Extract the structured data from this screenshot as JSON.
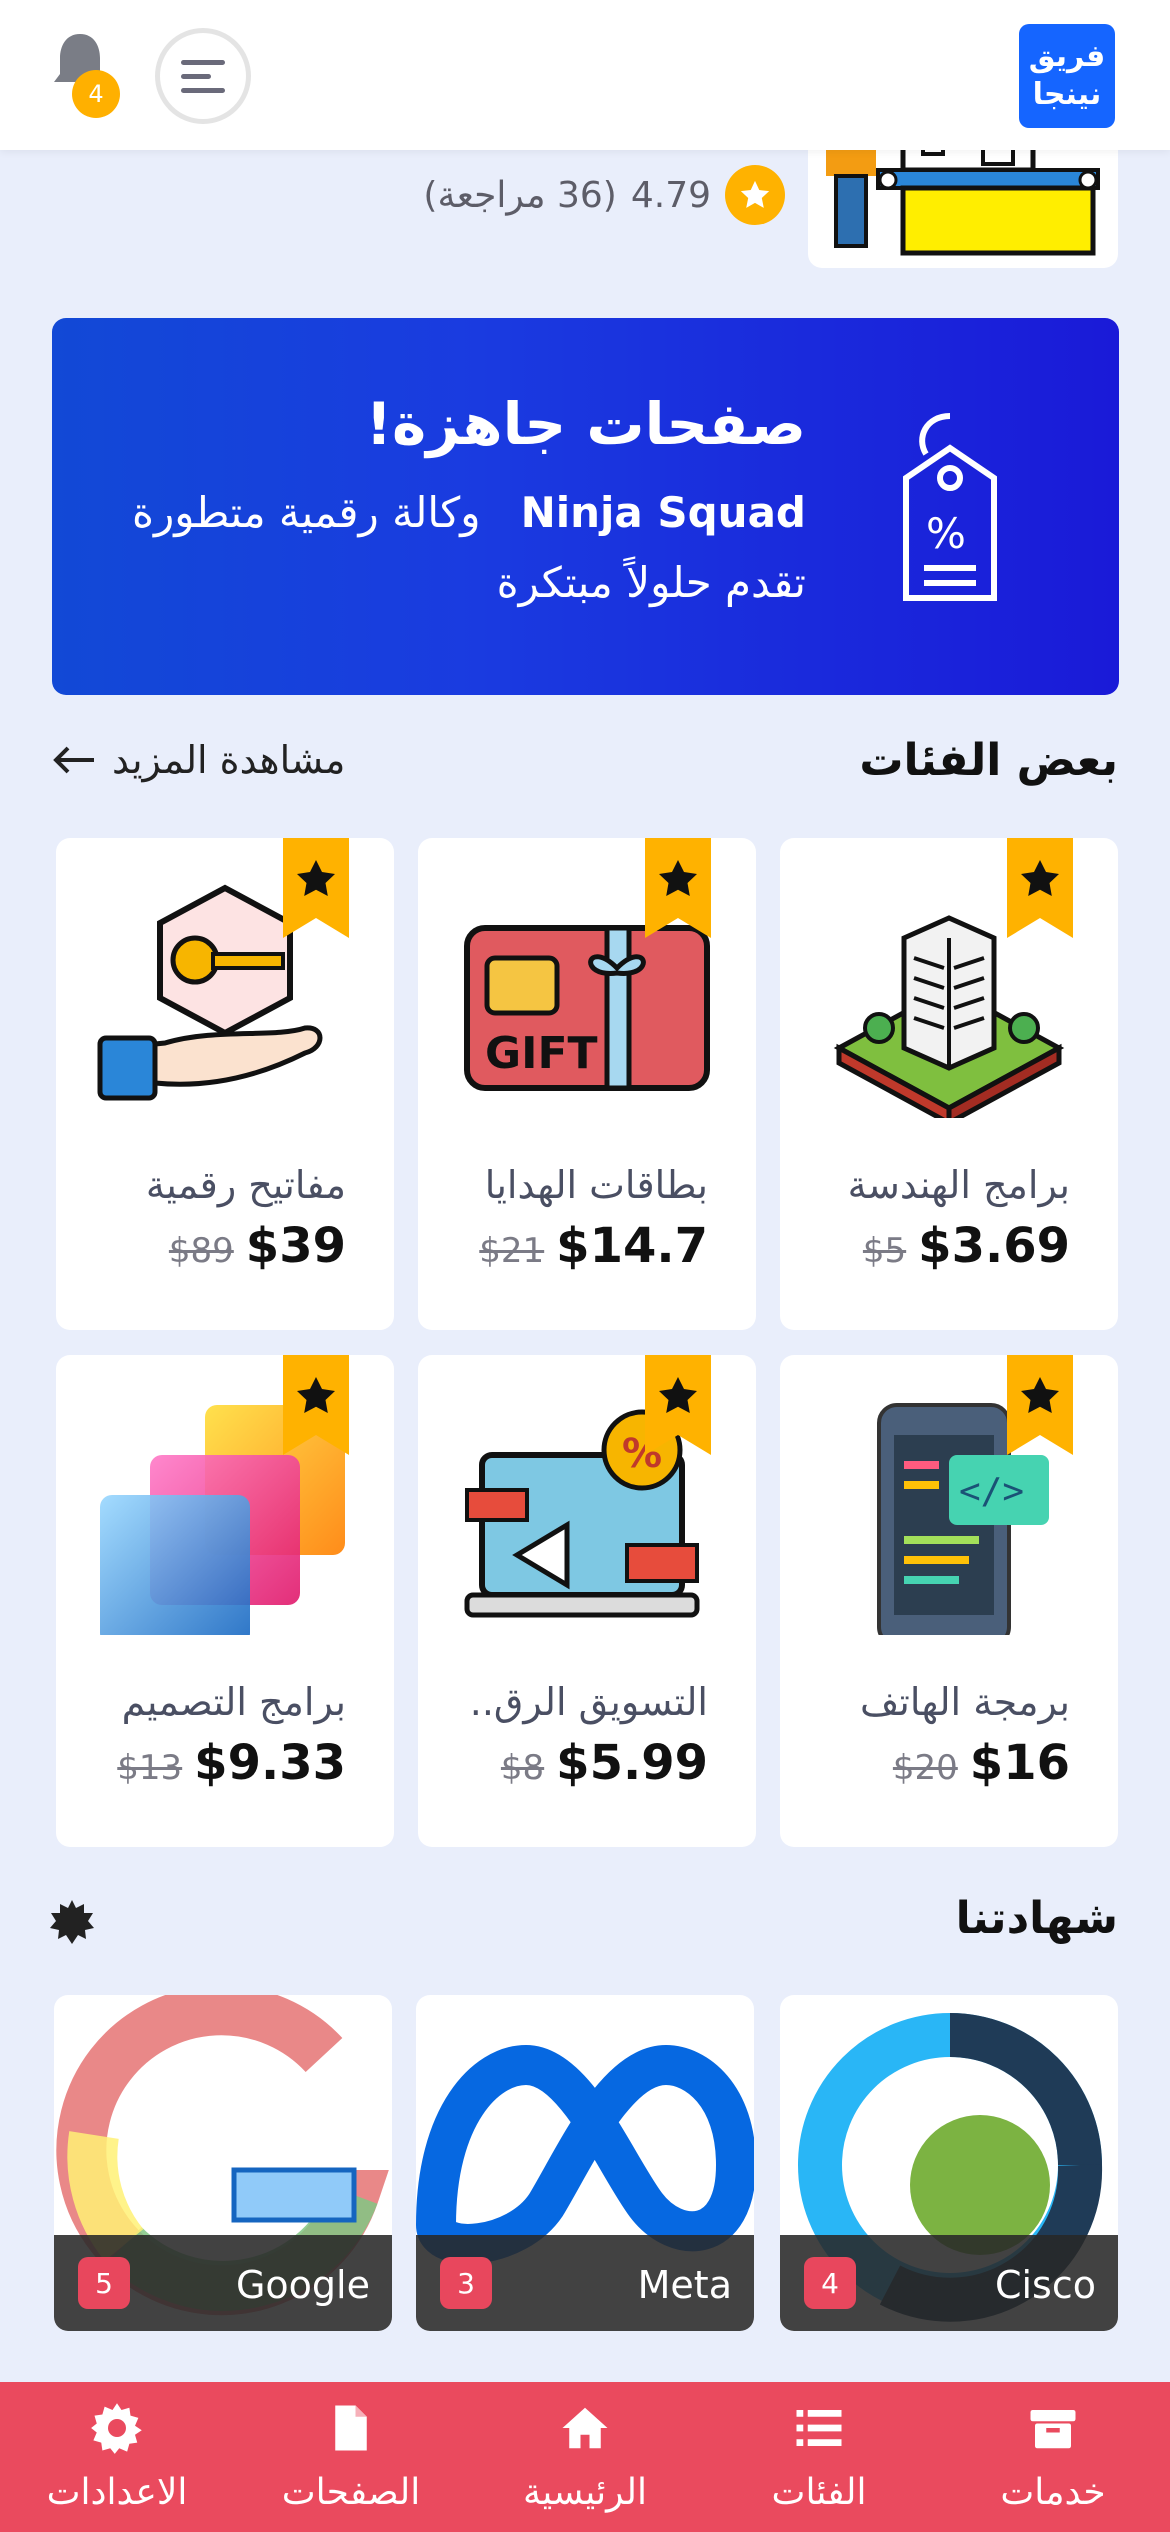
{
  "header": {
    "logo_line1": "فريق",
    "logo_line2": "نينجا",
    "notification_count": "4"
  },
  "top_product": {
    "rating": "4.79",
    "reviews": "(36 مراجعة)"
  },
  "banner": {
    "title": "صفحات جاهزة!",
    "line1_brand": "Ninja Squad",
    "line1_rest": "وكالة رقمية متطورة",
    "line2": "تقدم حلولاً مبتكرة"
  },
  "categories_section": {
    "title": "بعض الفئات",
    "see_more": "مشاهدة المزيد"
  },
  "products": [
    {
      "name": "برامج الهندسة",
      "price": "$3.69",
      "old_price": "$5",
      "icon": "building-icon"
    },
    {
      "name": "بطاقات الهدايا",
      "price": "$14.7",
      "old_price": "$21",
      "icon": "gift-card-icon"
    },
    {
      "name": "مفاتيح رقمية",
      "price": "$39",
      "old_price": "$89",
      "icon": "key-icon"
    },
    {
      "name": "برمجة الهاتف",
      "price": "$16",
      "old_price": "$20",
      "icon": "mobile-code-icon"
    },
    {
      "name": "التسويق الرق..",
      "price": "$5.99",
      "old_price": "$8",
      "icon": "marketing-icon"
    },
    {
      "name": "برامج التصميم",
      "price": "$9.33",
      "old_price": "$13",
      "icon": "design-icon"
    }
  ],
  "certificates_section": {
    "title": "شهادتنا"
  },
  "certificates": [
    {
      "name": "Cisco",
      "count": "4"
    },
    {
      "name": "Meta",
      "count": "3"
    },
    {
      "name": "Google",
      "count": "5"
    }
  ],
  "bottom_nav": [
    {
      "label": "خدمات",
      "icon": "box-icon"
    },
    {
      "label": "الفئات",
      "icon": "list-icon"
    },
    {
      "label": "الرئيسية",
      "icon": "home-icon"
    },
    {
      "label": "الصفحات",
      "icon": "file-icon"
    },
    {
      "label": "الاعدادات",
      "icon": "gear-icon"
    }
  ],
  "colors": {
    "accent": "#ea4a5e",
    "banner_start": "#1249d6",
    "banner_end": "#1a1ad8",
    "star": "#ffb200",
    "logo_bg": "#1565ff"
  }
}
